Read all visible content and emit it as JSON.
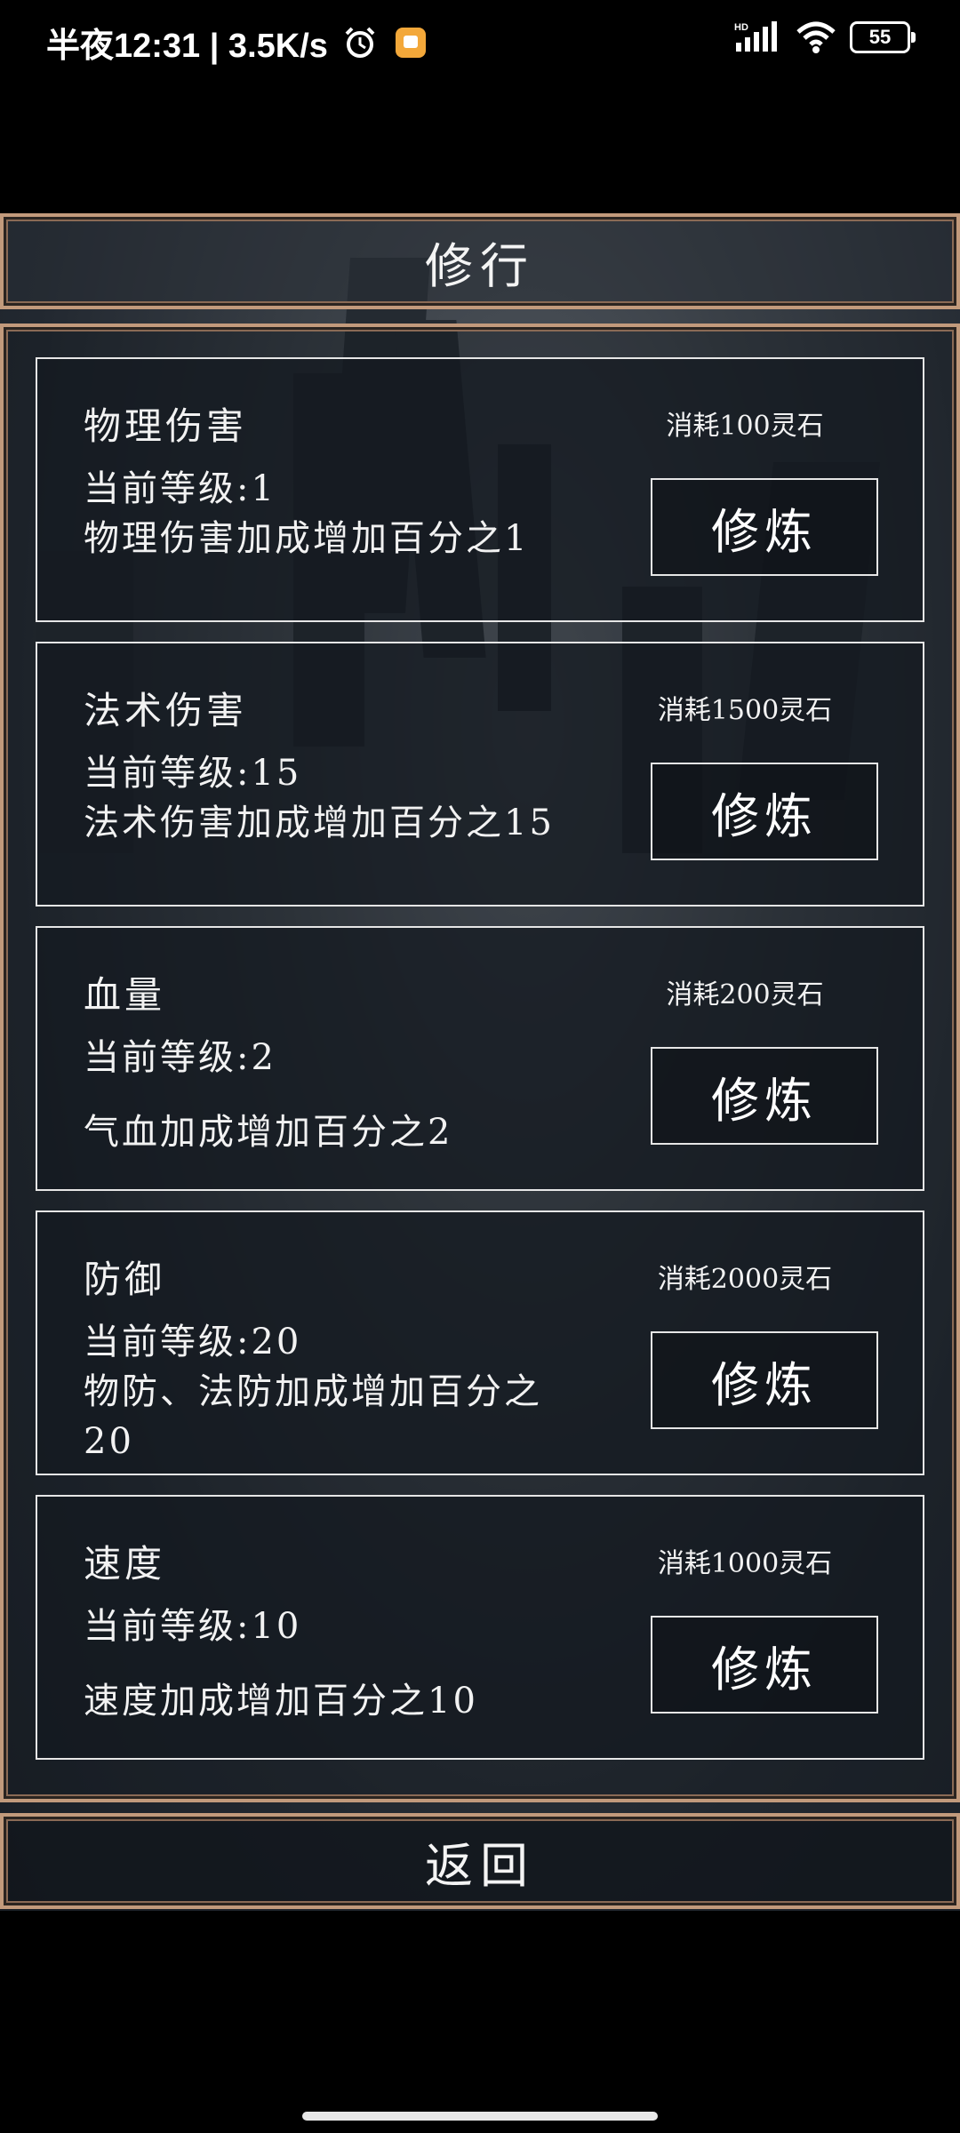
{
  "status_bar": {
    "time": "半夜12:31 | 3.5K/s",
    "network_label": "HD",
    "battery": "55",
    "icons": [
      "alarm-icon",
      "app-badge-icon",
      "signal-icon",
      "wifi-icon",
      "battery-icon"
    ]
  },
  "header": {
    "title": "修行"
  },
  "cards": [
    {
      "name": "物理伤害",
      "cost": "消耗100灵石",
      "level": "当前等级:1",
      "desc": "物理伤害加成增加百分之1",
      "button": "修炼"
    },
    {
      "name": "法术伤害",
      "cost": "消耗1500灵石",
      "level": "当前等级:15",
      "desc": "法术伤害加成增加百分之15",
      "button": "修炼"
    },
    {
      "name": "血量",
      "cost": "消耗200灵石",
      "level": "当前等级:2",
      "desc": "气血加成增加百分之2",
      "button": "修炼"
    },
    {
      "name": "防御",
      "cost": "消耗2000灵石",
      "level": "当前等级:20",
      "desc": "物防、法防加成增加百分之20",
      "button": "修炼"
    },
    {
      "name": "速度",
      "cost": "消耗1000灵石",
      "level": "当前等级:10",
      "desc": "速度加成增加百分之10",
      "button": "修炼"
    }
  ],
  "footer": {
    "back_label": "返回"
  },
  "colors": {
    "frame": "#c29a7c",
    "card_border": "#e6e6e6",
    "background": "#000000"
  }
}
